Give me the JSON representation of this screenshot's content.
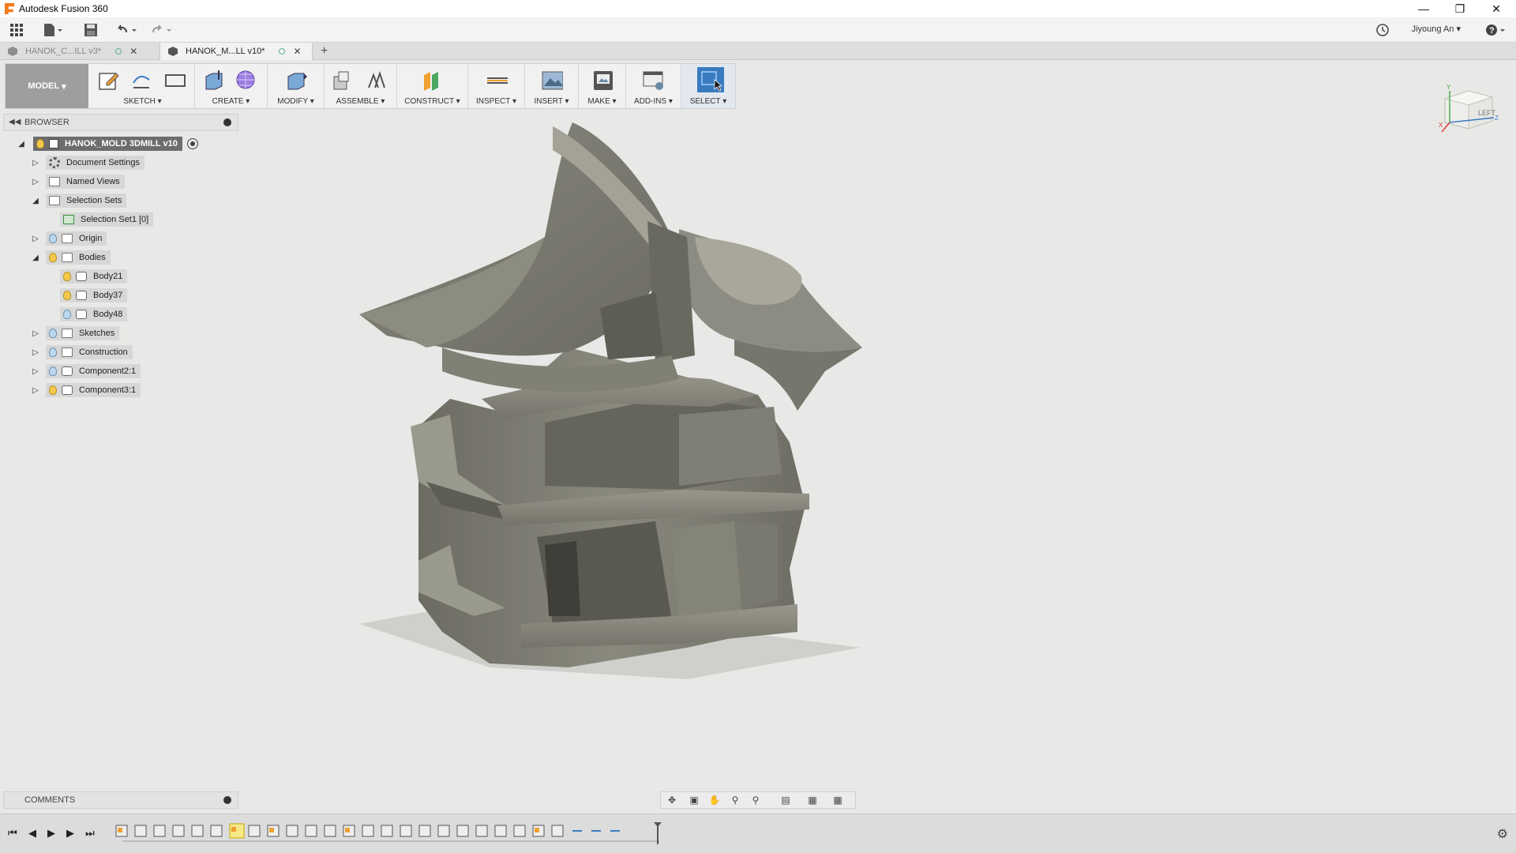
{
  "app": {
    "title": "Autodesk Fusion 360",
    "user": "Jiyoung An"
  },
  "tabs": [
    {
      "label": "HANOK_C...ILL v3*",
      "active": false
    },
    {
      "label": "HANOK_M...LL v10*",
      "active": true
    }
  ],
  "toolbar": {
    "workspace": "MODEL",
    "groups": [
      {
        "label": "SKETCH"
      },
      {
        "label": "CREATE"
      },
      {
        "label": "MODIFY"
      },
      {
        "label": "ASSEMBLE"
      },
      {
        "label": "CONSTRUCT"
      },
      {
        "label": "INSPECT"
      },
      {
        "label": "INSERT"
      },
      {
        "label": "MAKE"
      },
      {
        "label": "ADD-INS"
      },
      {
        "label": "SELECT"
      }
    ]
  },
  "browser": {
    "title": "BROWSER",
    "root": "HANOK_MOLD 3DMILL v10",
    "nodes": [
      {
        "label": "Document Settings"
      },
      {
        "label": "Named Views"
      },
      {
        "label": "Selection Sets"
      },
      {
        "label": "Selection Set1 [0]"
      },
      {
        "label": "Origin"
      },
      {
        "label": "Bodies"
      },
      {
        "label": "Body21"
      },
      {
        "label": "Body37"
      },
      {
        "label": "Body48"
      },
      {
        "label": "Sketches"
      },
      {
        "label": "Construction"
      },
      {
        "label": "Component2:1"
      },
      {
        "label": "Component3:1"
      }
    ]
  },
  "viewcube": {
    "face": "LEFT",
    "axes": [
      "X",
      "Y",
      "Z"
    ]
  },
  "comments": {
    "title": "COMMENTS"
  },
  "colors": {
    "model": "#7b7a70",
    "background": "#e8e9e6",
    "accent": "#3a7bbf"
  }
}
